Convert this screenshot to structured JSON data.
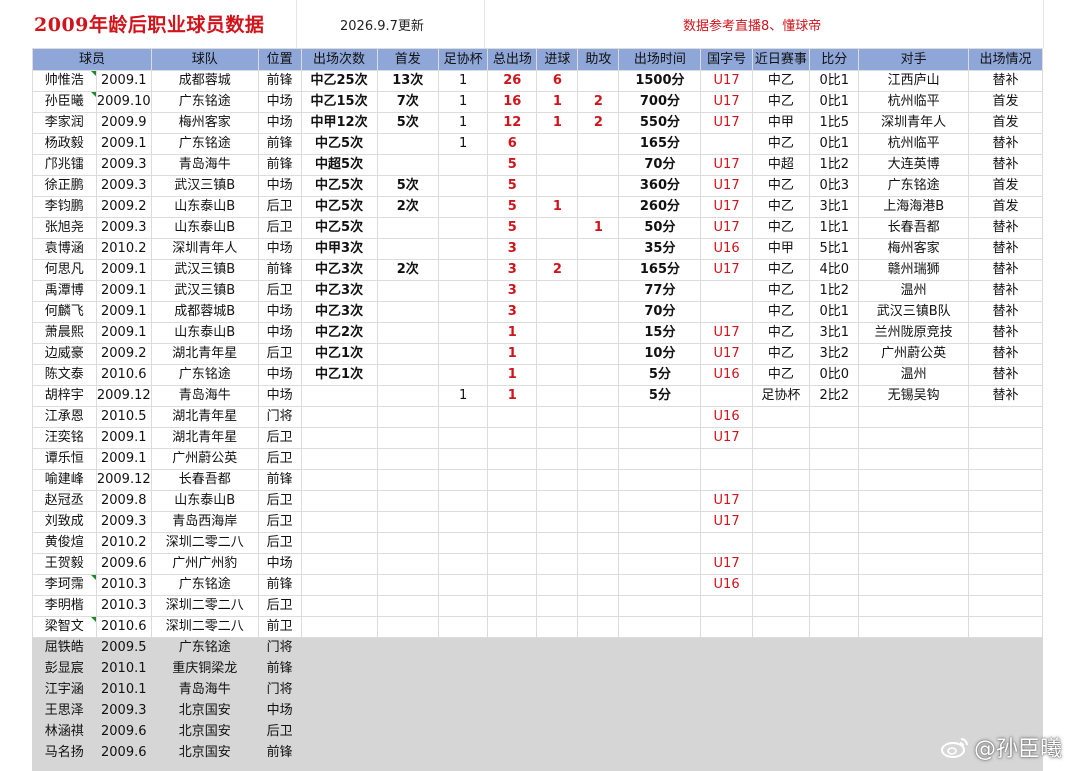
{
  "title": "2009年龄后职业球员数据",
  "update_date": "2026.9.7更新",
  "source_note": "数据参考直播8、懂球帝",
  "columns": [
    "球员",
    "球队",
    "位置",
    "出场次数",
    "首发",
    "足协杯",
    "总出场",
    "进球",
    "助攻",
    "出场时间",
    "国字号",
    "近日赛事",
    "比分",
    "对手",
    "出场情况"
  ],
  "rows": [
    {
      "name": "帅惟浩",
      "birth": "2009.1",
      "team": "成都蓉城",
      "pos": "前锋",
      "apps": "中乙25次",
      "starts": "13次",
      "cup": "1",
      "total": "26",
      "goals": "6",
      "assists": "",
      "minutes": "1500分",
      "youth": "U17",
      "recent": "中乙",
      "score": "0比1",
      "opp": "江西庐山",
      "status": "替补",
      "flag": true
    },
    {
      "name": "孙臣曦",
      "birth": "2009.10",
      "team": "广东铭途",
      "pos": "中场",
      "apps": "中乙15次",
      "starts": "7次",
      "cup": "1",
      "total": "16",
      "goals": "1",
      "assists": "2",
      "minutes": "700分",
      "youth": "U17",
      "recent": "中乙",
      "score": "0比1",
      "opp": "杭州临平",
      "status": "首发",
      "flag": true
    },
    {
      "name": "李家润",
      "birth": "2009.9",
      "team": "梅州客家",
      "pos": "中场",
      "apps": "中甲12次",
      "starts": "5次",
      "cup": "1",
      "total": "12",
      "goals": "1",
      "assists": "2",
      "minutes": "550分",
      "youth": "U17",
      "recent": "中甲",
      "score": "1比5",
      "opp": "深圳青年人",
      "status": "首发",
      "flag": false
    },
    {
      "name": "杨政毅",
      "birth": "2009.1",
      "team": "广东铭途",
      "pos": "前锋",
      "apps": "中乙5次",
      "starts": "",
      "cup": "1",
      "total": "6",
      "goals": "",
      "assists": "",
      "minutes": "165分",
      "youth": "",
      "recent": "中乙",
      "score": "0比1",
      "opp": "杭州临平",
      "status": "替补",
      "flag": false
    },
    {
      "name": "邝兆镭",
      "birth": "2009.3",
      "team": "青岛海牛",
      "pos": "前锋",
      "apps": "中超5次",
      "starts": "",
      "cup": "",
      "total": "5",
      "goals": "",
      "assists": "",
      "minutes": "70分",
      "youth": "U17",
      "recent": "中超",
      "score": "1比2",
      "opp": "大连英博",
      "status": "替补",
      "flag": false
    },
    {
      "name": "徐正鹏",
      "birth": "2009.3",
      "team": "武汉三镇B",
      "pos": "中场",
      "apps": "中乙5次",
      "starts": "5次",
      "cup": "",
      "total": "5",
      "goals": "",
      "assists": "",
      "minutes": "360分",
      "youth": "U17",
      "recent": "中乙",
      "score": "0比3",
      "opp": "广东铭途",
      "status": "首发",
      "flag": false
    },
    {
      "name": "李钧鹏",
      "birth": "2009.2",
      "team": "山东泰山B",
      "pos": "后卫",
      "apps": "中乙5次",
      "starts": "2次",
      "cup": "",
      "total": "5",
      "goals": "1",
      "assists": "",
      "minutes": "260分",
      "youth": "U17",
      "recent": "中乙",
      "score": "3比1",
      "opp": "上海海港B",
      "status": "首发",
      "flag": false
    },
    {
      "name": "张旭尧",
      "birth": "2009.3",
      "team": "山东泰山B",
      "pos": "后卫",
      "apps": "中乙5次",
      "starts": "",
      "cup": "",
      "total": "5",
      "goals": "",
      "assists": "1",
      "minutes": "50分",
      "youth": "U17",
      "recent": "中乙",
      "score": "1比1",
      "opp": "长春吾都",
      "status": "替补",
      "flag": false
    },
    {
      "name": "袁博涵",
      "birth": "2010.2",
      "team": "深圳青年人",
      "pos": "中场",
      "apps": "中甲3次",
      "starts": "",
      "cup": "",
      "total": "3",
      "goals": "",
      "assists": "",
      "minutes": "35分",
      "youth": "U16",
      "recent": "中甲",
      "score": "5比1",
      "opp": "梅州客家",
      "status": "替补",
      "flag": false
    },
    {
      "name": "何思凡",
      "birth": "2009.1",
      "team": "武汉三镇B",
      "pos": "前锋",
      "apps": "中乙3次",
      "starts": "2次",
      "cup": "",
      "total": "3",
      "goals": "2",
      "assists": "",
      "minutes": "165分",
      "youth": "U17",
      "recent": "中乙",
      "score": "4比0",
      "opp": "赣州瑞狮",
      "status": "替补",
      "flag": false
    },
    {
      "name": "禹潭博",
      "birth": "2009.1",
      "team": "武汉三镇B",
      "pos": "后卫",
      "apps": "中乙3次",
      "starts": "",
      "cup": "",
      "total": "3",
      "goals": "",
      "assists": "",
      "minutes": "77分",
      "youth": "",
      "recent": "中乙",
      "score": "1比2",
      "opp": "温州",
      "status": "替补",
      "flag": false
    },
    {
      "name": "何麟飞",
      "birth": "2009.1",
      "team": "成都蓉城B",
      "pos": "中场",
      "apps": "中乙3次",
      "starts": "",
      "cup": "",
      "total": "3",
      "goals": "",
      "assists": "",
      "minutes": "70分",
      "youth": "",
      "recent": "中乙",
      "score": "0比1",
      "opp": "武汉三镇B队",
      "status": "替补",
      "flag": false
    },
    {
      "name": "萧晨熙",
      "birth": "2009.1",
      "team": "山东泰山B",
      "pos": "中场",
      "apps": "中乙2次",
      "starts": "",
      "cup": "",
      "total": "1",
      "goals": "",
      "assists": "",
      "minutes": "15分",
      "youth": "U17",
      "recent": "中乙",
      "score": "3比1",
      "opp": "兰州陇原竞技",
      "status": "替补",
      "flag": false
    },
    {
      "name": "边威豪",
      "birth": "2009.2",
      "team": "湖北青年星",
      "pos": "后卫",
      "apps": "中乙1次",
      "starts": "",
      "cup": "",
      "total": "1",
      "goals": "",
      "assists": "",
      "minutes": "10分",
      "youth": "U17",
      "recent": "中乙",
      "score": "3比2",
      "opp": "广州蔚公英",
      "status": "替补",
      "flag": false
    },
    {
      "name": "陈文泰",
      "birth": "2010.6",
      "team": "广东铭途",
      "pos": "中场",
      "apps": "中乙1次",
      "starts": "",
      "cup": "",
      "total": "1",
      "goals": "",
      "assists": "",
      "minutes": "5分",
      "youth": "U16",
      "recent": "中乙",
      "score": "0比0",
      "opp": "温州",
      "status": "替补",
      "flag": false
    },
    {
      "name": "胡梓宇",
      "birth": "2009.12",
      "team": "青岛海牛",
      "pos": "中场",
      "apps": "",
      "starts": "",
      "cup": "1",
      "total": "1",
      "goals": "",
      "assists": "",
      "minutes": "5分",
      "youth": "",
      "recent": "足协杯",
      "score": "2比2",
      "opp": "无锡吴钩",
      "status": "替补",
      "flag": false
    },
    {
      "name": "江承恩",
      "birth": "2010.5",
      "team": "湖北青年星",
      "pos": "门将",
      "apps": "",
      "starts": "",
      "cup": "",
      "total": "",
      "goals": "",
      "assists": "",
      "minutes": "",
      "youth": "U16",
      "recent": "",
      "score": "",
      "opp": "",
      "status": "",
      "flag": false
    },
    {
      "name": "汪奕铭",
      "birth": "2009.1",
      "team": "湖北青年星",
      "pos": "后卫",
      "apps": "",
      "starts": "",
      "cup": "",
      "total": "",
      "goals": "",
      "assists": "",
      "minutes": "",
      "youth": "U17",
      "recent": "",
      "score": "",
      "opp": "",
      "status": "",
      "flag": false
    },
    {
      "name": "谭乐恒",
      "birth": "2009.1",
      "team": "广州蔚公英",
      "pos": "后卫",
      "apps": "",
      "starts": "",
      "cup": "",
      "total": "",
      "goals": "",
      "assists": "",
      "minutes": "",
      "youth": "",
      "recent": "",
      "score": "",
      "opp": "",
      "status": "",
      "flag": false
    },
    {
      "name": "喻建峰",
      "birth": "2009.12",
      "team": "长春吾都",
      "pos": "前锋",
      "apps": "",
      "starts": "",
      "cup": "",
      "total": "",
      "goals": "",
      "assists": "",
      "minutes": "",
      "youth": "",
      "recent": "",
      "score": "",
      "opp": "",
      "status": "",
      "flag": false
    },
    {
      "name": "赵冠丞",
      "birth": "2009.8",
      "team": "山东泰山B",
      "pos": "后卫",
      "apps": "",
      "starts": "",
      "cup": "",
      "total": "",
      "goals": "",
      "assists": "",
      "minutes": "",
      "youth": "U17",
      "recent": "",
      "score": "",
      "opp": "",
      "status": "",
      "flag": false
    },
    {
      "name": "刘致成",
      "birth": "2009.3",
      "team": "青岛西海岸",
      "pos": "后卫",
      "apps": "",
      "starts": "",
      "cup": "",
      "total": "",
      "goals": "",
      "assists": "",
      "minutes": "",
      "youth": "U17",
      "recent": "",
      "score": "",
      "opp": "",
      "status": "",
      "flag": false
    },
    {
      "name": "黄俊煊",
      "birth": "2010.2",
      "team": "深圳二零二八",
      "pos": "后卫",
      "apps": "",
      "starts": "",
      "cup": "",
      "total": "",
      "goals": "",
      "assists": "",
      "minutes": "",
      "youth": "",
      "recent": "",
      "score": "",
      "opp": "",
      "status": "",
      "flag": false
    },
    {
      "name": "王贺毅",
      "birth": "2009.6",
      "team": "广州广州豹",
      "pos": "中场",
      "apps": "",
      "starts": "",
      "cup": "",
      "total": "",
      "goals": "",
      "assists": "",
      "minutes": "",
      "youth": "U17",
      "recent": "",
      "score": "",
      "opp": "",
      "status": "",
      "flag": false
    },
    {
      "name": "李珂霈",
      "birth": "2010.3",
      "team": "广东铭途",
      "pos": "前锋",
      "apps": "",
      "starts": "",
      "cup": "",
      "total": "",
      "goals": "",
      "assists": "",
      "minutes": "",
      "youth": "U16",
      "recent": "",
      "score": "",
      "opp": "",
      "status": "",
      "flag": true
    },
    {
      "name": "李明楷",
      "birth": "2010.3",
      "team": "深圳二零二八",
      "pos": "后卫",
      "apps": "",
      "starts": "",
      "cup": "",
      "total": "",
      "goals": "",
      "assists": "",
      "minutes": "",
      "youth": "",
      "recent": "",
      "score": "",
      "opp": "",
      "status": "",
      "flag": false
    },
    {
      "name": "梁智文",
      "birth": "2010.6",
      "team": "深圳二零二八",
      "pos": "前卫",
      "apps": "",
      "starts": "",
      "cup": "",
      "total": "",
      "goals": "",
      "assists": "",
      "minutes": "",
      "youth": "",
      "recent": "",
      "score": "",
      "opp": "",
      "status": "",
      "flag": true
    },
    {
      "name": "屈铁皓",
      "birth": "2009.5",
      "team": "广东铭途",
      "pos": "门将",
      "apps": "",
      "starts": "",
      "cup": "",
      "total": "",
      "goals": "",
      "assists": "",
      "minutes": "",
      "youth": "",
      "recent": "",
      "score": "",
      "opp": "",
      "status": "",
      "flag": false,
      "grey": true
    },
    {
      "name": "彭显宸",
      "birth": "2010.1",
      "team": "重庆铜梁龙",
      "pos": "前锋",
      "apps": "",
      "starts": "",
      "cup": "",
      "total": "",
      "goals": "",
      "assists": "",
      "minutes": "",
      "youth": "",
      "recent": "",
      "score": "",
      "opp": "",
      "status": "",
      "flag": false,
      "grey": true
    },
    {
      "name": "江宇涵",
      "birth": "2010.1",
      "team": "青岛海牛",
      "pos": "门将",
      "apps": "",
      "starts": "",
      "cup": "",
      "total": "",
      "goals": "",
      "assists": "",
      "minutes": "",
      "youth": "",
      "recent": "",
      "score": "",
      "opp": "",
      "status": "",
      "flag": false,
      "grey": true
    },
    {
      "name": "王思泽",
      "birth": "2009.3",
      "team": "北京国安",
      "pos": "中场",
      "apps": "",
      "starts": "",
      "cup": "",
      "total": "",
      "goals": "",
      "assists": "",
      "minutes": "",
      "youth": "",
      "recent": "",
      "score": "",
      "opp": "",
      "status": "",
      "flag": false,
      "grey": true
    },
    {
      "name": "林涵祺",
      "birth": "2009.6",
      "team": "北京国安",
      "pos": "后卫",
      "apps": "",
      "starts": "",
      "cup": "",
      "total": "",
      "goals": "",
      "assists": "",
      "minutes": "",
      "youth": "",
      "recent": "",
      "score": "",
      "opp": "",
      "status": "",
      "flag": false,
      "grey": true
    },
    {
      "name": "马名扬",
      "birth": "2009.6",
      "team": "北京国安",
      "pos": "前锋",
      "apps": "",
      "starts": "",
      "cup": "",
      "total": "",
      "goals": "",
      "assists": "",
      "minutes": "",
      "youth": "",
      "recent": "",
      "score": "",
      "opp": "",
      "status": "",
      "flag": false,
      "grey": true
    }
  ],
  "watermark": "@孙臣曦",
  "colors": {
    "title_red": "#d0141b",
    "header_blue": "#8ea6d8",
    "grey_band": "#d6d6d6",
    "flag_green": "#1a8a2a"
  }
}
